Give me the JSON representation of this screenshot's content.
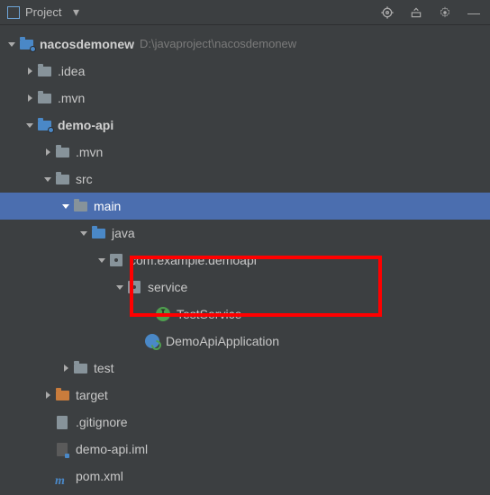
{
  "titlebar": {
    "title": "Project"
  },
  "root": {
    "name": "nacosdemonew",
    "path": "D:\\javaproject\\nacosdemonew"
  },
  "idea": ".idea",
  "mvn": ".mvn",
  "demoapi": {
    "name": "demo-api",
    "mvn": ".mvn",
    "src": "src",
    "main": "main",
    "java": "java",
    "pkg": "com.example.demoapi",
    "service": "service",
    "testservice": "TestService",
    "app": "DemoApiApplication",
    "test": "test",
    "target": "target",
    "gitignore": ".gitignore",
    "iml": "demo-api.iml",
    "pom": "pom.xml"
  }
}
